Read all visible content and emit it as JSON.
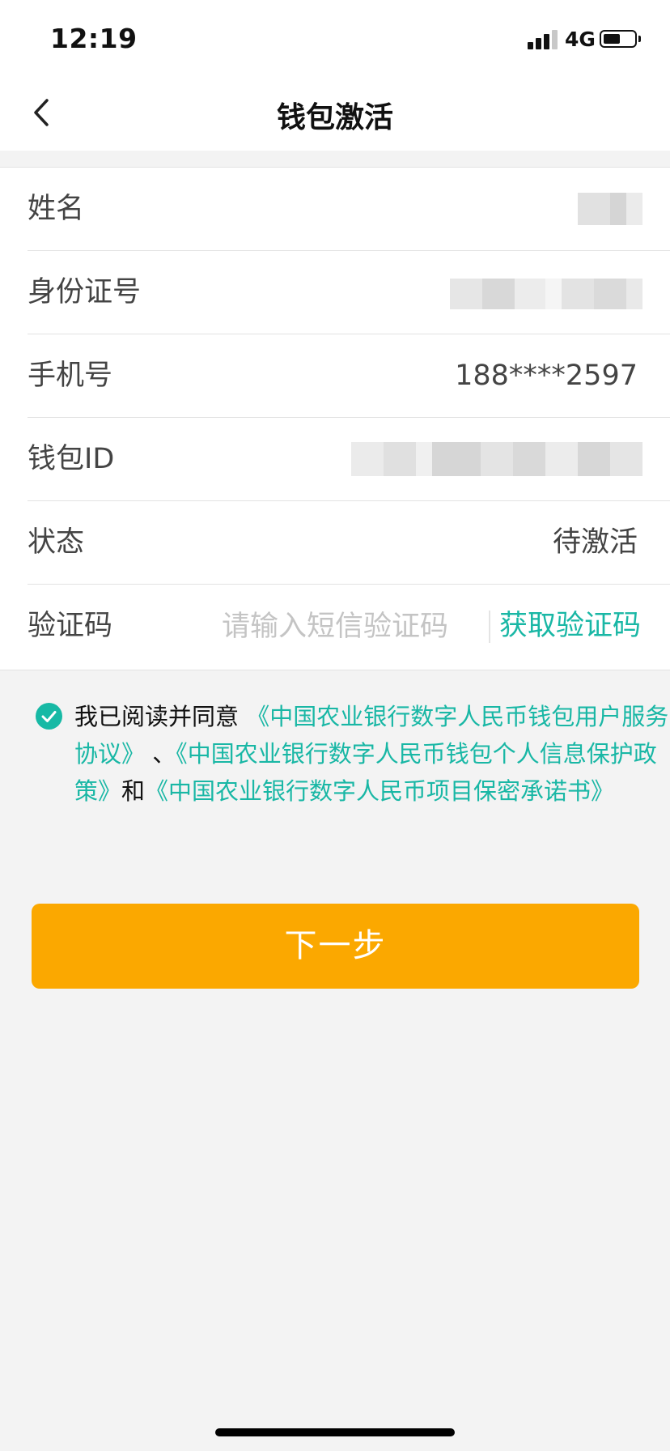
{
  "status_bar": {
    "time": "12:19",
    "network": "4G",
    "battery_percent": 55
  },
  "nav": {
    "title": "钱包激活",
    "back_icon": "chevron-left-icon"
  },
  "form": {
    "name": {
      "label": "姓名"
    },
    "id_number": {
      "label": "身份证号"
    },
    "phone": {
      "label": "手机号",
      "value": "188****2597"
    },
    "wallet_id": {
      "label": "钱包ID"
    },
    "status": {
      "label": "状态",
      "value": "待激活"
    },
    "sms_code": {
      "label": "验证码",
      "placeholder": "请输入短信验证码",
      "value": "",
      "get_code_label": "获取验证码"
    }
  },
  "agreement": {
    "checked": true,
    "check_icon": "check-circle-icon",
    "prefix": "我已阅读并同意",
    "link1": "《中国农业银行数字人民币钱包用户服务协议》",
    "sep": "、",
    "link2": "《中国农业银行数字人民币钱包个人信息保护政策》",
    "conj": "和",
    "link3": "《中国农业银行数字人民币项目保密承诺书》"
  },
  "next_button": {
    "label": "下一步"
  },
  "colors": {
    "accent": "#19b7a5",
    "primary_button": "#fba800",
    "background": "#f3f3f3"
  }
}
